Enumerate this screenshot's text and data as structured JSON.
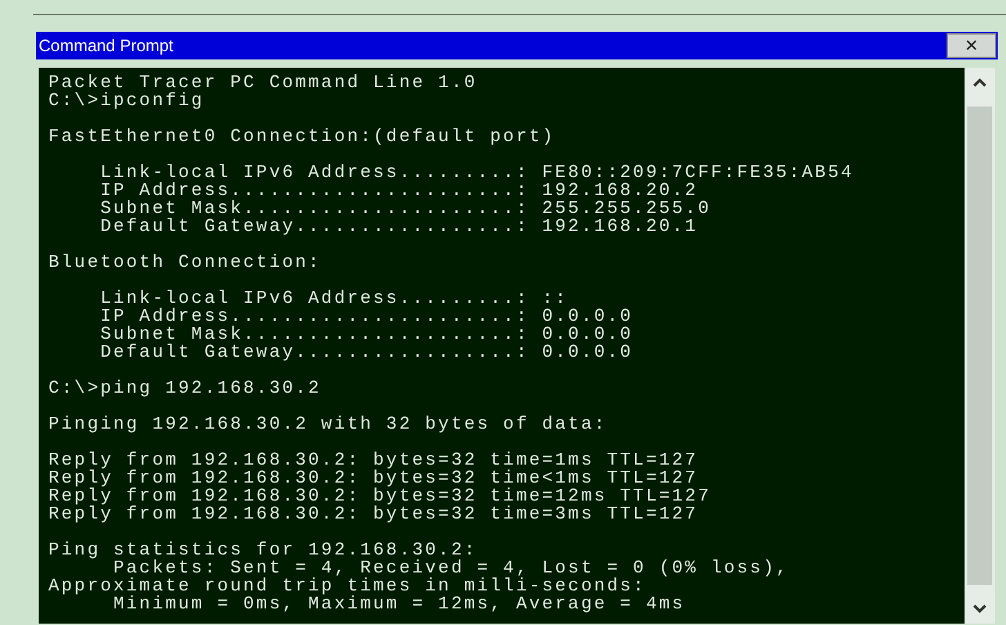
{
  "window": {
    "title": "Command Prompt",
    "close": "✕"
  },
  "terminal": {
    "blocks": [
      [
        "Packet Tracer PC Command Line 1.0",
        "C:\\>ipconfig"
      ],
      [
        "FastEthernet0 Connection:(default port)"
      ],
      [
        "    Link-local IPv6 Address.........: FE80::209:7CFF:FE35:AB54",
        "    IP Address......................: 192.168.20.2",
        "    Subnet Mask.....................: 255.255.255.0",
        "    Default Gateway.................: 192.168.20.1"
      ],
      [
        "Bluetooth Connection:"
      ],
      [
        "    Link-local IPv6 Address.........: ::",
        "    IP Address......................: 0.0.0.0",
        "    Subnet Mask.....................: 0.0.0.0",
        "    Default Gateway.................: 0.0.0.0"
      ],
      [
        "C:\\>ping 192.168.30.2"
      ],
      [
        "Pinging 192.168.30.2 with 32 bytes of data:"
      ],
      [
        "Reply from 192.168.30.2: bytes=32 time=1ms TTL=127",
        "Reply from 192.168.30.2: bytes=32 time<1ms TTL=127",
        "Reply from 192.168.30.2: bytes=32 time=12ms TTL=127",
        "Reply from 192.168.30.2: bytes=32 time=3ms TTL=127"
      ],
      [
        "Ping statistics for 192.168.30.2:",
        "     Packets: Sent = 4, Received = 4, Lost = 0 (0% loss),",
        "Approximate round trip times in milli-seconds:",
        "     Minimum = 0ms, Maximum = 12ms, Average = 4ms"
      ]
    ]
  }
}
